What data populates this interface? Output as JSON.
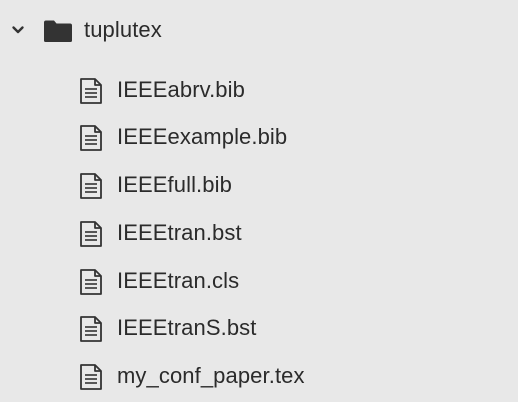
{
  "folder": {
    "name": "tuplutex",
    "expanded": true,
    "icon": "folder-icon",
    "chevron_icon": "chevron-down-icon"
  },
  "files": [
    {
      "name": "IEEEabrv.bib",
      "icon": "document-icon"
    },
    {
      "name": "IEEEexample.bib",
      "icon": "document-icon"
    },
    {
      "name": "IEEEfull.bib",
      "icon": "document-icon"
    },
    {
      "name": "IEEEtran.bst",
      "icon": "document-icon"
    },
    {
      "name": "IEEEtran.cls",
      "icon": "document-icon"
    },
    {
      "name": "IEEEtranS.bst",
      "icon": "document-icon"
    },
    {
      "name": "my_conf_paper.tex",
      "icon": "document-icon"
    }
  ],
  "colors": {
    "background": "#e8e8e8",
    "text": "#2b2b2b",
    "icon": "#333333"
  }
}
